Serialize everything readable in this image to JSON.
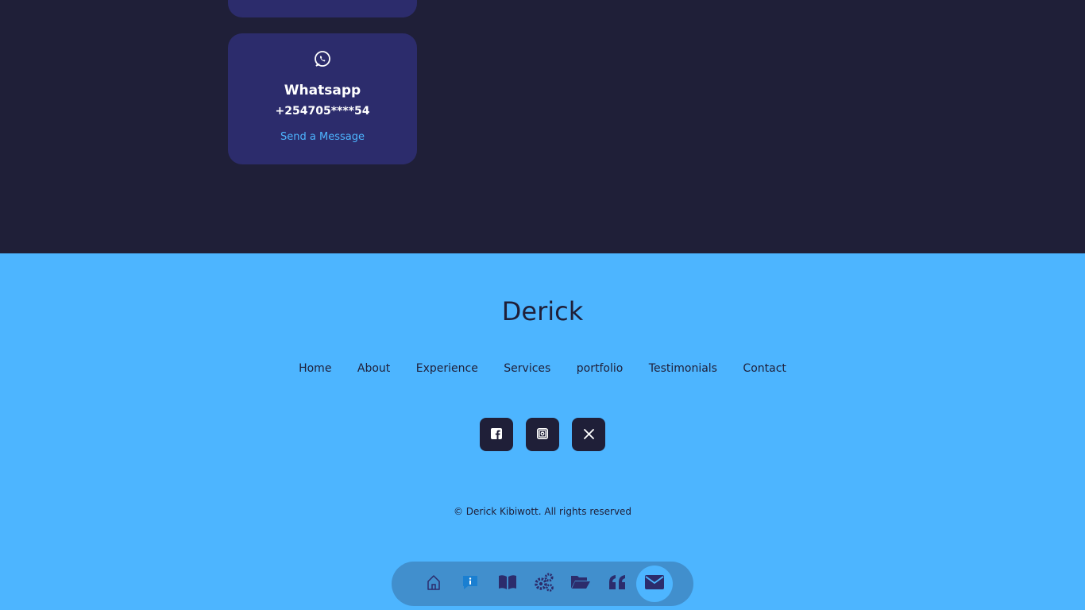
{
  "contact": {
    "whatsapp": {
      "icon": "whatsapp-icon",
      "title": "Whatsapp",
      "phone": "+254705****54",
      "link": "Send a Message"
    }
  },
  "footer": {
    "logo": "Derick",
    "nav": [
      "Home",
      "About",
      "Experience",
      "Services",
      "portfolio",
      "Testimonials",
      "Contact"
    ],
    "socials": [
      "facebook-icon",
      "instagram-icon",
      "x-twitter-icon"
    ],
    "copyright": "© Derick Kibiwott. All rights reserved"
  },
  "dock": {
    "items": [
      "home-icon",
      "about-icon",
      "book-icon",
      "gears-icon",
      "folder-icon",
      "quote-icon",
      "envelope-icon"
    ],
    "active": "envelope-icon"
  },
  "colors": {
    "background": "#1f1f38",
    "card": "#2c2c6c",
    "accent": "#4db5ff"
  }
}
